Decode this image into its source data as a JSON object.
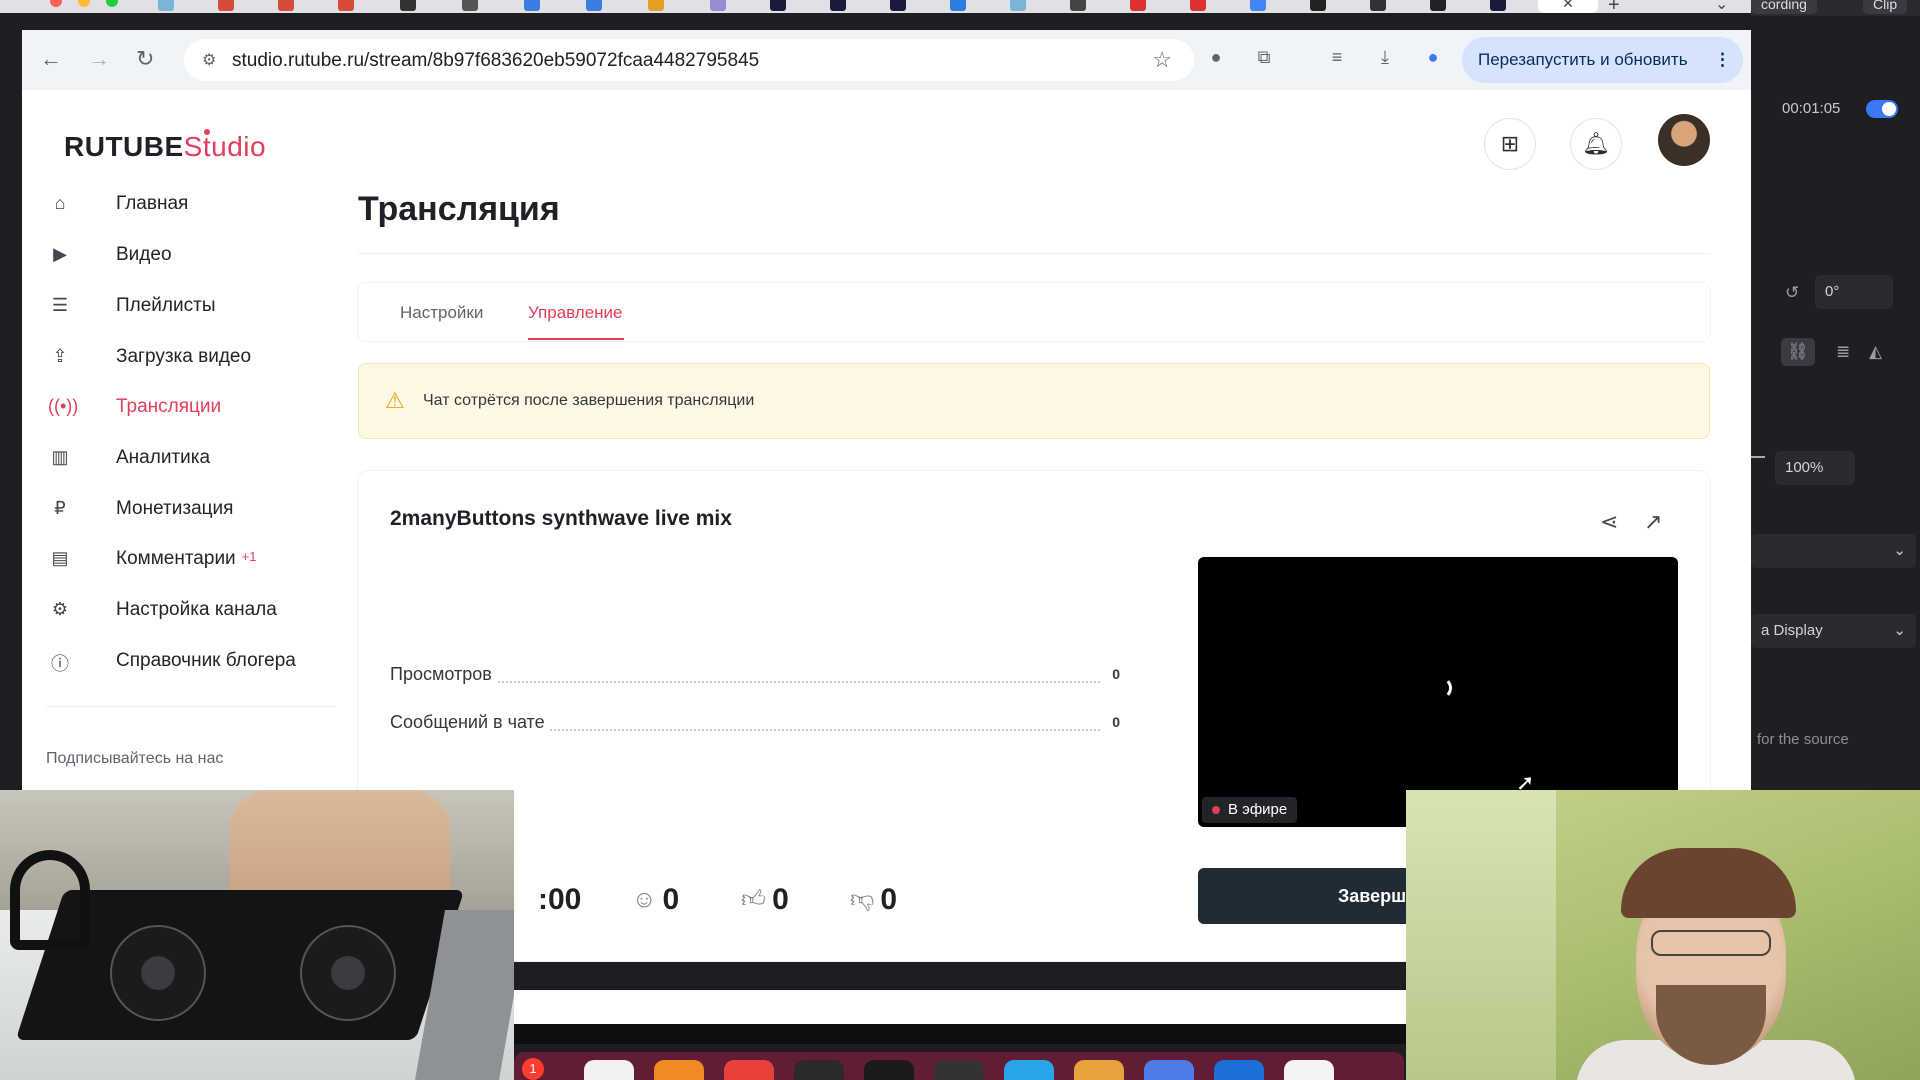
{
  "browser": {
    "url": "studio.rutube.ru/stream/8b97f683620eb59072fcaa4482795845",
    "relaunch_label": "Перезапустить и обновить",
    "close_tab": "✕",
    "new_tab": "+",
    "tab_menu": "⌄"
  },
  "right_panel": {
    "pills": [
      "cording",
      "Clip"
    ],
    "timer": "00:01:05",
    "rotation": "0°",
    "scale": "100%",
    "display_select": "a Display",
    "note": "for the source"
  },
  "logo": {
    "rutube": "RUTUBE",
    "studio": "Studio"
  },
  "sidebar": {
    "items": [
      {
        "label": "Главная",
        "icon": "home-icon"
      },
      {
        "label": "Видео",
        "icon": "video-icon"
      },
      {
        "label": "Плейлисты",
        "icon": "playlist-icon"
      },
      {
        "label": "Загрузка видео",
        "icon": "upload-icon"
      },
      {
        "label": "Трансляции",
        "icon": "broadcast-icon",
        "active": true
      },
      {
        "label": "Аналитика",
        "icon": "analytics-icon"
      },
      {
        "label": "Монетизация",
        "icon": "ruble-icon"
      },
      {
        "label": "Комментарии",
        "icon": "comment-icon",
        "badge": "+1"
      },
      {
        "label": "Настройка канала",
        "icon": "gear-icon"
      },
      {
        "label": "Справочник блогера",
        "icon": "info-icon"
      }
    ],
    "follow_label": "Подписывайтесь на нас"
  },
  "main": {
    "title": "Трансляция",
    "tabs": [
      {
        "label": "Настройки"
      },
      {
        "label": "Управление",
        "active": true
      }
    ],
    "warning": "Чат сотрётся после завершения трансляции",
    "stream": {
      "title": "2manyButtons synthwave live mix",
      "stats": [
        {
          "label": "Просмотров",
          "value": "0"
        },
        {
          "label": "Сообщений в чате",
          "value": "0"
        }
      ],
      "live_badge": "В эфире",
      "timer_partial": ":00",
      "viewers": "0",
      "likes": "0",
      "dislikes": "0",
      "finish_button": "Заверш"
    }
  },
  "colors": {
    "accent": "#e23e5a",
    "warning_bg": "#fff8e4",
    "dark_button": "#1f2b35"
  }
}
